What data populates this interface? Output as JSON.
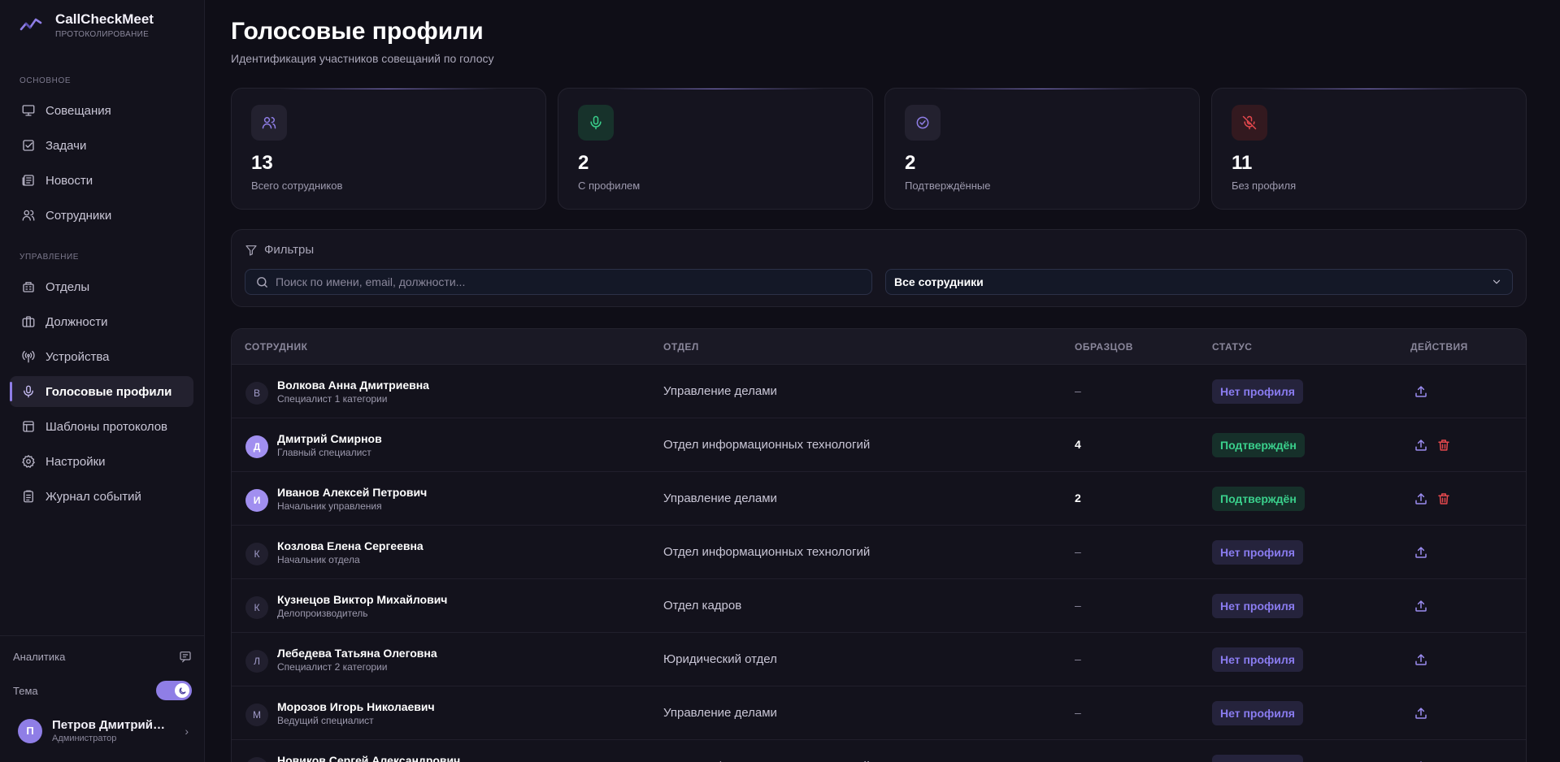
{
  "brand": {
    "name": "CallCheckMeet",
    "subtitle": "ПРОТОКОЛИРОВАНИЕ"
  },
  "sidebar": {
    "sections": [
      "ОСНОВНОЕ",
      "УПРАВЛЕНИЕ"
    ],
    "main_items": [
      {
        "label": "Совещания",
        "icon": "presentation-icon"
      },
      {
        "label": "Задачи",
        "icon": "checkbox-icon"
      },
      {
        "label": "Новости",
        "icon": "newspaper-icon"
      },
      {
        "label": "Сотрудники",
        "icon": "users-icon"
      }
    ],
    "admin_items": [
      {
        "label": "Отделы",
        "icon": "building-icon"
      },
      {
        "label": "Должности",
        "icon": "briefcase-icon"
      },
      {
        "label": "Устройства",
        "icon": "antenna-icon"
      },
      {
        "label": "Голосовые профили",
        "icon": "mic-icon",
        "active": true
      },
      {
        "label": "Шаблоны протоколов",
        "icon": "template-icon"
      },
      {
        "label": "Настройки",
        "icon": "gear-icon"
      },
      {
        "label": "Журнал событий",
        "icon": "clipboard-icon"
      }
    ],
    "analytics_label": "Аналитика",
    "theme_label": "Тема",
    "user": {
      "initial": "П",
      "name": "Петров Дмитрий Сергеевич",
      "role": "Администратор"
    }
  },
  "header": {
    "title": "Голосовые профили",
    "subtitle": "Идентификация участников совещаний по голосу"
  },
  "stats": [
    {
      "value": "13",
      "label": "Всего сотрудников",
      "icon": "users-icon",
      "color": "#8f7ee6",
      "bg": "#23212f"
    },
    {
      "value": "2",
      "label": "С профилем",
      "icon": "mic-icon",
      "color": "#3ad08c",
      "bg": "#17322b"
    },
    {
      "value": "2",
      "label": "Подтверждённые",
      "icon": "check-circle-icon",
      "color": "#8f7ee6",
      "bg": "#23212f"
    },
    {
      "value": "11",
      "label": "Без профиля",
      "icon": "mic-off-icon",
      "color": "#e5484d",
      "bg": "#33191f"
    }
  ],
  "filters": {
    "title": "Фильтры",
    "search_placeholder": "Поиск по имени, email, должности...",
    "select_value": "Все сотрудники"
  },
  "table": {
    "headers": [
      "СОТРУДНИК",
      "ОТДЕЛ",
      "ОБРАЗЦОВ",
      "СТАТУС",
      "ДЕЙСТВИЯ"
    ],
    "rows": [
      {
        "initial": "В",
        "name": "Волкова Анна Дмитриевна",
        "position": "Специалист 1 категории",
        "department": "Управление делами",
        "samples": "–",
        "status": "Нет профиля",
        "has_profile": false
      },
      {
        "initial": "Д",
        "name": "Дмитрий Смирнов",
        "position": "Главный специалист",
        "department": "Отдел информационных технологий",
        "samples": "4",
        "status": "Подтверждён",
        "has_profile": true
      },
      {
        "initial": "И",
        "name": "Иванов Алексей Петрович",
        "position": "Начальник управления",
        "department": "Управление делами",
        "samples": "2",
        "status": "Подтверждён",
        "has_profile": true
      },
      {
        "initial": "К",
        "name": "Козлова Елена Сергеевна",
        "position": "Начальник отдела",
        "department": "Отдел информационных технологий",
        "samples": "–",
        "status": "Нет профиля",
        "has_profile": false
      },
      {
        "initial": "К",
        "name": "Кузнецов Виктор Михайлович",
        "position": "Делопроизводитель",
        "department": "Отдел кадров",
        "samples": "–",
        "status": "Нет профиля",
        "has_profile": false
      },
      {
        "initial": "Л",
        "name": "Лебедева Татьяна Олеговна",
        "position": "Специалист 2 категории",
        "department": "Юридический отдел",
        "samples": "–",
        "status": "Нет профиля",
        "has_profile": false
      },
      {
        "initial": "М",
        "name": "Морозов Игорь Николаевич",
        "position": "Ведущий специалист",
        "department": "Управление делами",
        "samples": "–",
        "status": "Нет профиля",
        "has_profile": false
      },
      {
        "initial": "Н",
        "name": "Новиков Сергей Александрович",
        "position": "",
        "department": "Отдел информационных технологий",
        "samples": "–",
        "status": "Нет профиля",
        "has_profile": false
      }
    ]
  }
}
